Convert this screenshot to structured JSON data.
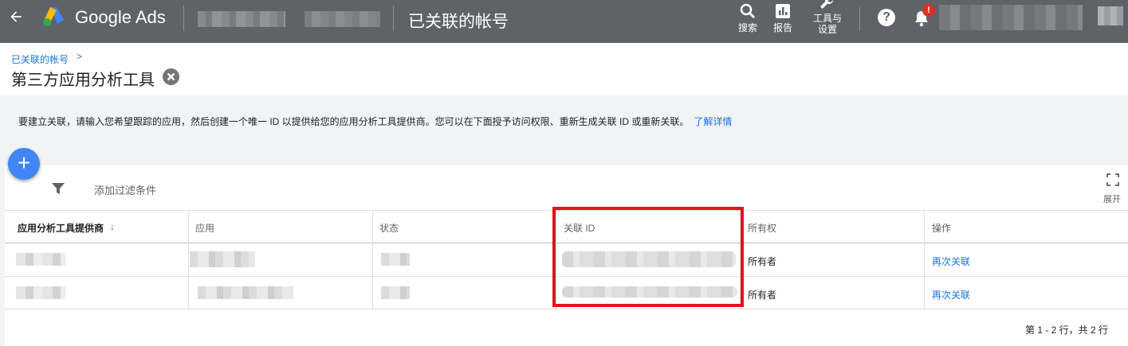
{
  "topbar": {
    "brand": "Google Ads",
    "page_name": "已关联的帐号",
    "search_label": "搜索",
    "report_label": "报告",
    "tools_label_1": "工具与",
    "tools_label_2": "设置",
    "notification_badge": "!",
    "help_glyph": "?"
  },
  "header": {
    "breadcrumb": "已关联的帐号",
    "breadcrumb_chevron": ">",
    "title": "第三方应用分析工具"
  },
  "info": {
    "text": "要建立关联，请输入您希望跟踪的应用，然后创建一个唯一 ID 以提供给您的应用分析工具提供商。您可以在下面授予访问权限、重新生成关联 ID 或重新关联。",
    "link": "了解详情"
  },
  "toolbar": {
    "add_glyph": "+",
    "filter_label": "添加过滤条件",
    "expand_label": "展开"
  },
  "table": {
    "columns": [
      "应用分析工具提供商",
      "应用",
      "状态",
      "关联 ID",
      "所有权",
      "操作"
    ],
    "sort_glyph": "↓",
    "rows": [
      {
        "ownership": "所有者",
        "action": "再次关联"
      },
      {
        "ownership": "所有者",
        "action": "再次关联"
      }
    ]
  },
  "footer": {
    "pagination": "第 1 - 2 行，共 2 行"
  },
  "colors": {
    "topbar": "#5f6368",
    "link": "#1a73e8",
    "fab": "#4285f4",
    "highlight_box": "#e0141e",
    "badge": "#d93025"
  }
}
